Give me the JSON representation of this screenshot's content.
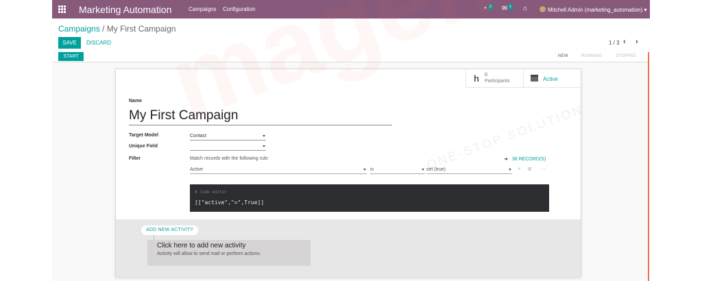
{
  "topbar": {
    "app_title": "Marketing Automation",
    "menu": [
      "Campaigns",
      "Configuration"
    ],
    "activity_badge": "2",
    "message_badge": "1",
    "user": "Mitchell Admin (marketing_automation)",
    "color": "#875a7b"
  },
  "breadcrumb": {
    "parent": "Campaigns",
    "separator": "/",
    "current": "My First Campaign"
  },
  "buttons": {
    "save": "SAVE",
    "discard": "DISCARD",
    "start": "START"
  },
  "pager": {
    "value": "1 / 3",
    "prev_icon": "chevron-left-icon",
    "next_icon": "chevron-right-icon"
  },
  "stages": [
    "NEW",
    "RUNNING",
    "STOPPED"
  ],
  "button_box": {
    "participants_count": "0",
    "participants_label": "Participants",
    "active_label": "Active"
  },
  "form": {
    "name_label": "Name",
    "name_value": "My First Campaign",
    "target_model_label": "Target Model",
    "target_model_value": "Contact",
    "unique_field_label": "Unique Field",
    "unique_field_value": "",
    "filter_label": "Filter",
    "filter_text": "Match records with the following rule:",
    "records_count": "38 RECORD(S)",
    "domain": {
      "field": "Active",
      "operator": "is",
      "value": "set (true)"
    },
    "code_comment": "# Code editor",
    "code_value": "[[\"active\",\"=\",True]]"
  },
  "activities": {
    "add_label": "ADD NEW ACTIVITY",
    "card_title": "Click here to add new activity",
    "card_subtitle": "Activity will allow to send mail or perform actions."
  },
  "watermark": {
    "big": "magenest",
    "small": "ONE-STOP SOLUTION"
  },
  "colors": {
    "accent": "#00a09d",
    "status_accent": "#f0744f"
  }
}
